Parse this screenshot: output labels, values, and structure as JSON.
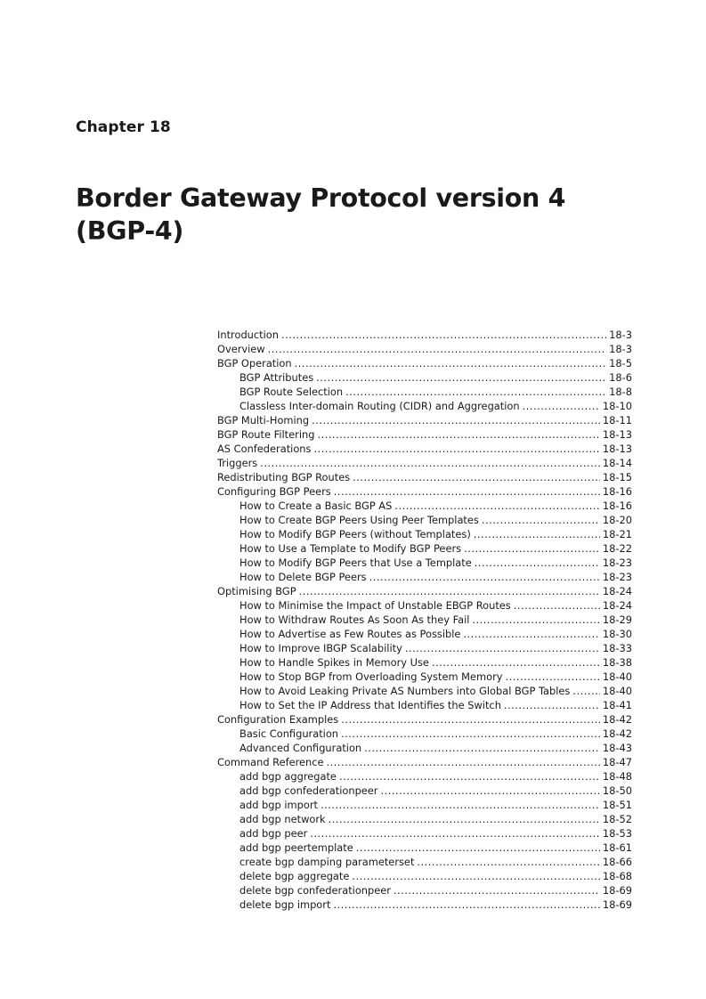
{
  "chapter": {
    "label": "Chapter 18",
    "title_line1": "Border Gateway Protocol version 4",
    "title_line2": "(BGP-4)"
  },
  "toc": [
    {
      "title": "Introduction",
      "page": "18-3",
      "level": 1
    },
    {
      "title": "Overview",
      "page": "18-3",
      "level": 1
    },
    {
      "title": "BGP Operation",
      "page": "18-5",
      "level": 1
    },
    {
      "title": "BGP Attributes",
      "page": "18-6",
      "level": 2
    },
    {
      "title": "BGP Route Selection",
      "page": "18-8",
      "level": 2
    },
    {
      "title": "Classless Inter-domain Routing (CIDR) and Aggregation",
      "page": "18-10",
      "level": 2
    },
    {
      "title": "BGP Multi-Homing",
      "page": "18-11",
      "level": 1
    },
    {
      "title": "BGP Route Filtering",
      "page": "18-13",
      "level": 1
    },
    {
      "title": "AS Confederations",
      "page": "18-13",
      "level": 1
    },
    {
      "title": "Triggers",
      "page": "18-14",
      "level": 1
    },
    {
      "title": "Redistributing BGP Routes",
      "page": "18-15",
      "level": 1
    },
    {
      "title": "Configuring BGP Peers",
      "page": "18-16",
      "level": 1
    },
    {
      "title": "How to Create a Basic BGP AS",
      "page": "18-16",
      "level": 2
    },
    {
      "title": "How to Create BGP Peers Using Peer Templates",
      "page": "18-20",
      "level": 2
    },
    {
      "title": "How to Modify BGP Peers (without Templates)",
      "page": "18-21",
      "level": 2
    },
    {
      "title": "How to Use a Template to Modify BGP Peers",
      "page": "18-22",
      "level": 2
    },
    {
      "title": "How to Modify BGP Peers that Use a Template",
      "page": "18-23",
      "level": 2
    },
    {
      "title": "How to Delete BGP Peers",
      "page": "18-23",
      "level": 2
    },
    {
      "title": "Optimising BGP",
      "page": "18-24",
      "level": 1
    },
    {
      "title": "How to Minimise the Impact of Unstable EBGP Routes",
      "page": "18-24",
      "level": 2
    },
    {
      "title": "How to Withdraw Routes As Soon As they Fail",
      "page": "18-29",
      "level": 2
    },
    {
      "title": "How to Advertise as Few Routes as Possible",
      "page": "18-30",
      "level": 2
    },
    {
      "title": "How to Improve IBGP Scalability",
      "page": "18-33",
      "level": 2
    },
    {
      "title": "How to Handle Spikes in Memory Use",
      "page": "18-38",
      "level": 2
    },
    {
      "title": "How to Stop BGP from Overloading System Memory",
      "page": "18-40",
      "level": 2
    },
    {
      "title": "How to Avoid Leaking Private AS Numbers into Global BGP Tables",
      "page": "18-40",
      "level": 2
    },
    {
      "title": "How to Set the IP Address that Identifies the Switch",
      "page": "18-41",
      "level": 2
    },
    {
      "title": "Configuration Examples",
      "page": "18-42",
      "level": 1
    },
    {
      "title": "Basic Configuration",
      "page": "18-42",
      "level": 2
    },
    {
      "title": "Advanced Configuration",
      "page": "18-43",
      "level": 2
    },
    {
      "title": "Command Reference",
      "page": "18-47",
      "level": 1
    },
    {
      "title": "add bgp aggregate",
      "page": "18-48",
      "level": 2
    },
    {
      "title": "add bgp confederationpeer",
      "page": "18-50",
      "level": 2
    },
    {
      "title": "add bgp import",
      "page": "18-51",
      "level": 2
    },
    {
      "title": "add bgp network",
      "page": "18-52",
      "level": 2
    },
    {
      "title": "add bgp peer",
      "page": "18-53",
      "level": 2
    },
    {
      "title": "add bgp peertemplate",
      "page": "18-61",
      "level": 2
    },
    {
      "title": "create bgp damping parameterset",
      "page": "18-66",
      "level": 2
    },
    {
      "title": "delete bgp aggregate",
      "page": "18-68",
      "level": 2
    },
    {
      "title": "delete bgp confederationpeer",
      "page": "18-69",
      "level": 2
    },
    {
      "title": "delete bgp import",
      "page": "18-69",
      "level": 2
    }
  ]
}
